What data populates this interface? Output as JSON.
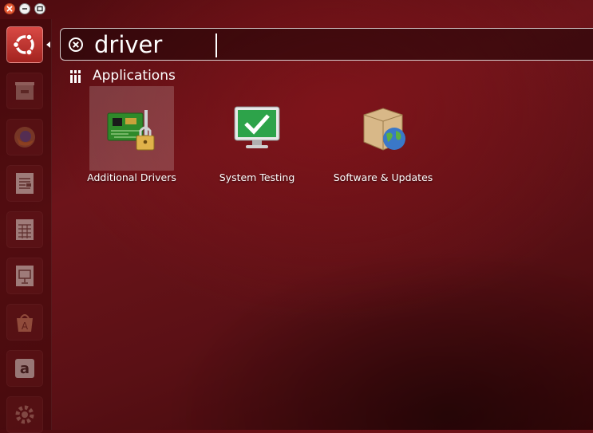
{
  "window_controls": {
    "close": "close-icon",
    "minimize": "minimize-icon",
    "maximize": "maximize-icon"
  },
  "launcher": {
    "items": [
      {
        "name": "dash-home",
        "icon": "ubuntu-logo-icon",
        "active": true
      },
      {
        "name": "files",
        "icon": "file-cabinet-icon"
      },
      {
        "name": "firefox",
        "icon": "firefox-icon"
      },
      {
        "name": "writer",
        "icon": "document-icon"
      },
      {
        "name": "calc",
        "icon": "spreadsheet-icon"
      },
      {
        "name": "impress",
        "icon": "presentation-icon"
      },
      {
        "name": "software-center",
        "icon": "shopping-bag-icon"
      },
      {
        "name": "amazon",
        "icon": "amazon-icon"
      },
      {
        "name": "settings",
        "icon": "gear-icon"
      }
    ]
  },
  "search": {
    "query": "driver"
  },
  "category": {
    "title": "Applications",
    "icon": "applications-category-icon"
  },
  "results": [
    {
      "label": "Additional Drivers",
      "icon": "circuit-board-lock-icon",
      "selected": true
    },
    {
      "label": "System Testing",
      "icon": "monitor-checkmark-icon",
      "selected": false
    },
    {
      "label": "Software & Updates",
      "icon": "package-globe-icon",
      "selected": false
    }
  ],
  "colors": {
    "accent": "#dd4814",
    "background": "#5a1015",
    "text": "#ffffff"
  }
}
